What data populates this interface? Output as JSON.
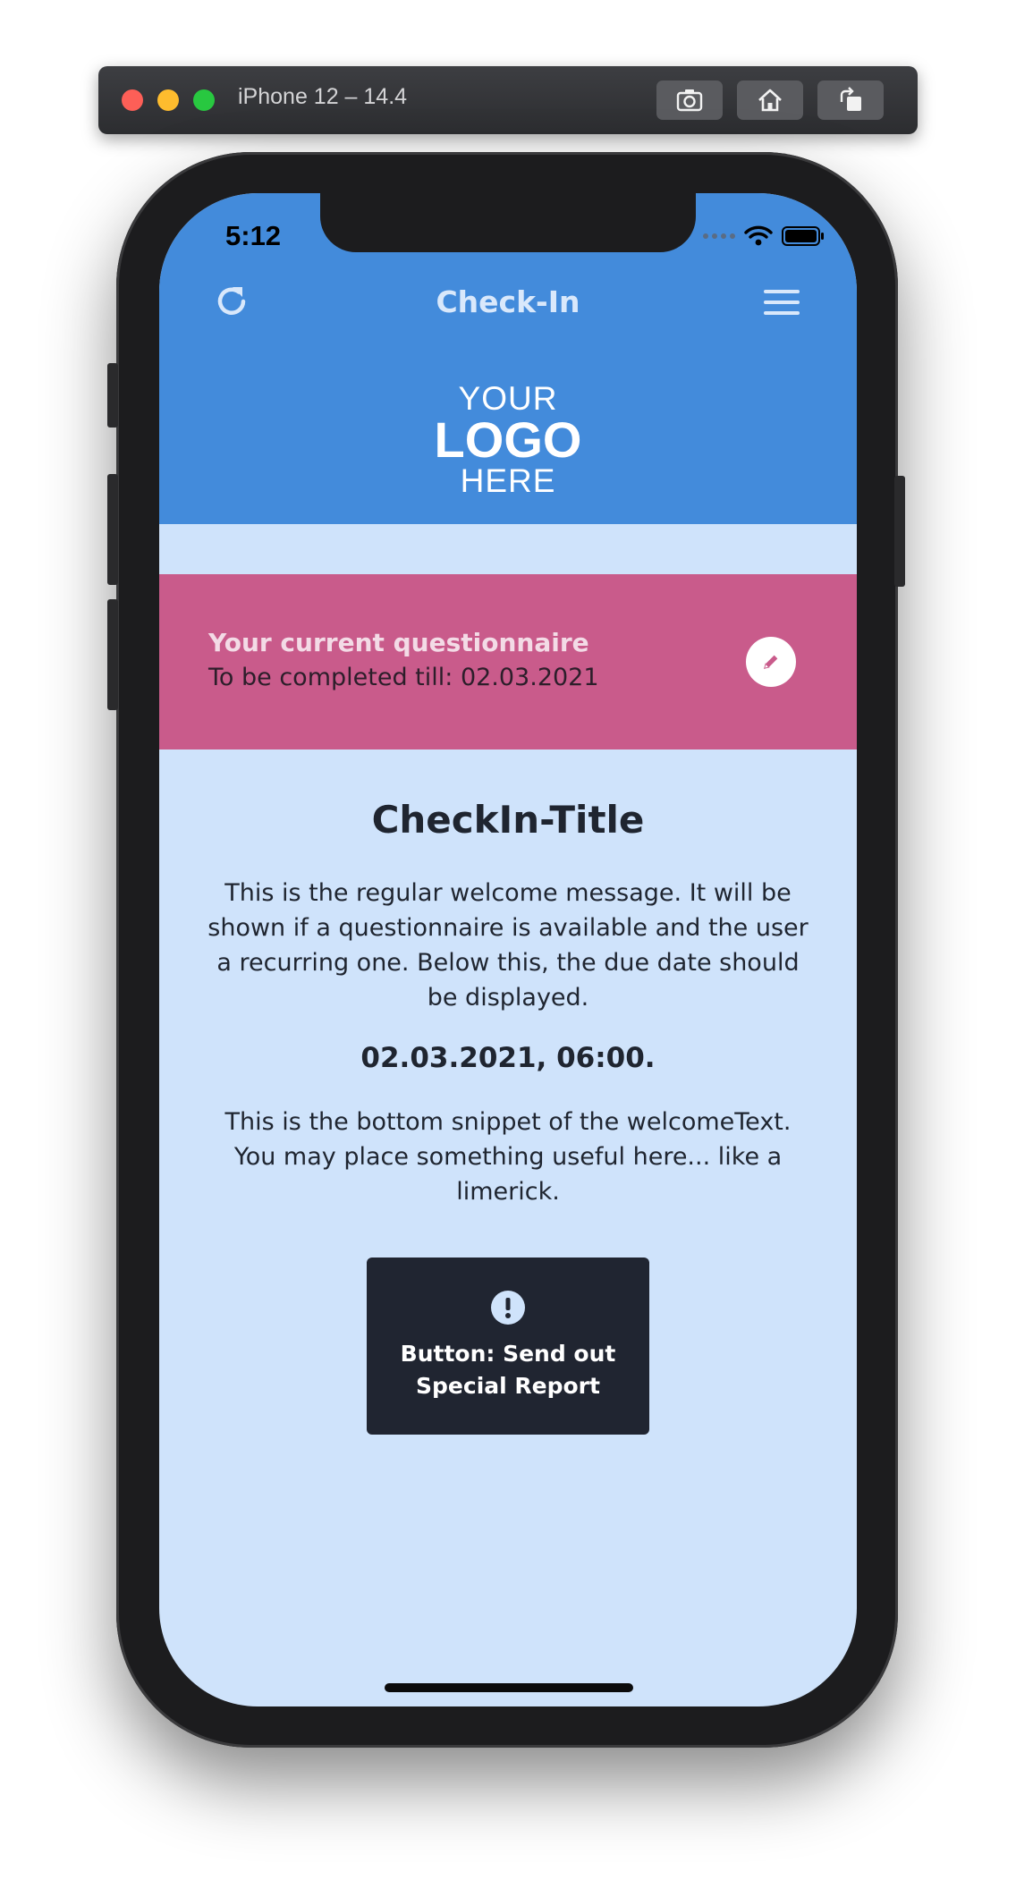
{
  "simulator": {
    "title": "iPhone 12 – 14.4",
    "buttons": [
      "screenshot-icon",
      "home-icon",
      "rotate-icon"
    ]
  },
  "status_bar": {
    "time": "5:12"
  },
  "nav": {
    "title": "Check-In",
    "left_icon": "refresh-icon",
    "right_icon": "menu-icon"
  },
  "logo": {
    "top": "YOUR",
    "middle": "LOGO",
    "bottom": "HERE"
  },
  "banner": {
    "title": "Your current questionnaire",
    "subtitle": "To be completed till:  02.03.2021",
    "icon": "pencil-icon"
  },
  "content": {
    "title": "CheckIn-Title",
    "welcome": "This is the regular welcome message. It will be shown if a questionnaire is available and the user a recurring one. Below this, the due date should be displayed.",
    "due_date": "02.03.2021, 06:00.",
    "bottom_text": "This is the bottom snippet of the welcomeText. You may place something useful here... like a limerick."
  },
  "special_button": {
    "label": "Button: Send out Special Report",
    "icon": "alert-icon"
  },
  "colors": {
    "header": "#438bdb",
    "background": "#cfe3fb",
    "banner": "#c95b8b",
    "button": "#202531"
  }
}
